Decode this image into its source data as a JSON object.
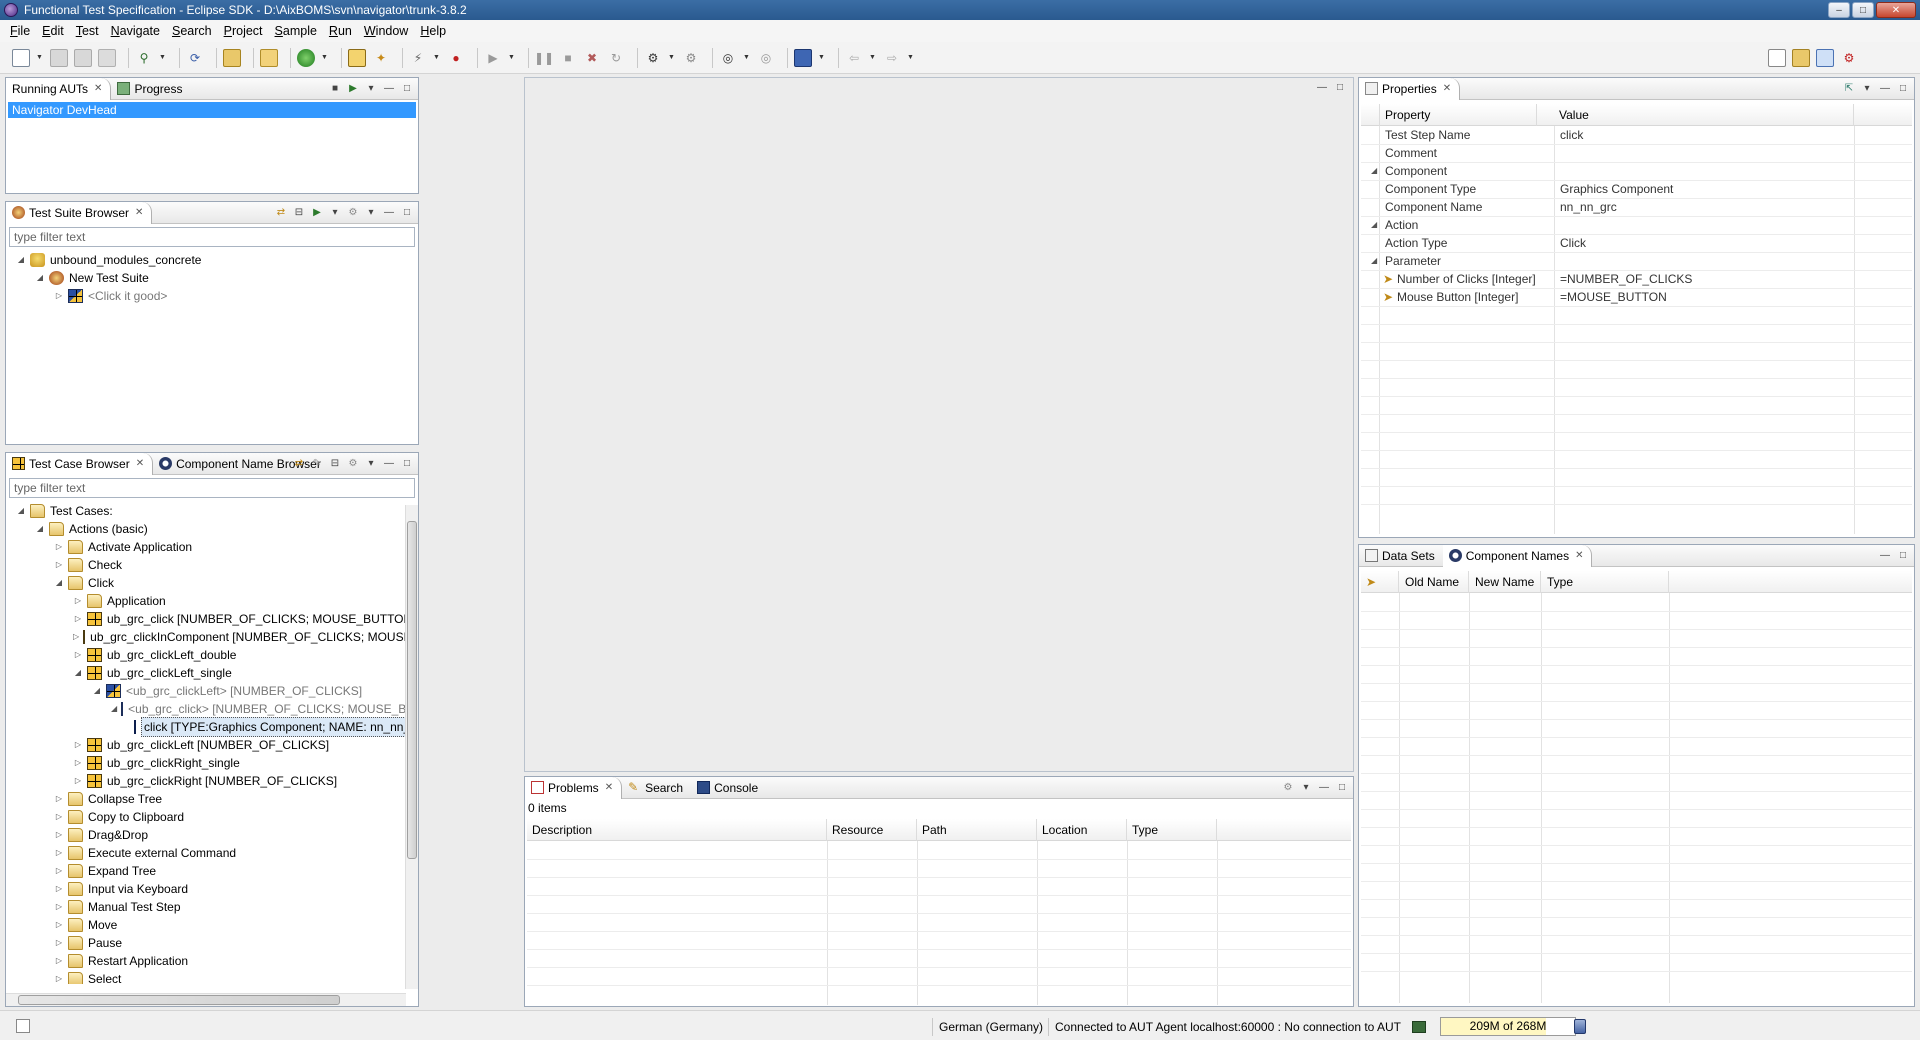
{
  "window": {
    "title": "Functional Test Specification - Eclipse SDK - D:\\AixBOMS\\svn\\navigator\\trunk-3.8.2"
  },
  "menu": [
    "File",
    "Edit",
    "Test",
    "Navigate",
    "Search",
    "Project",
    "Sample",
    "Run",
    "Window",
    "Help"
  ],
  "running_auts": {
    "tabs": [
      "Running AUTs",
      "Progress"
    ],
    "items": [
      "Navigator DevHead"
    ]
  },
  "test_suite_browser": {
    "tab": "Test Suite Browser",
    "filter_placeholder": "type filter text",
    "tree": [
      {
        "label": "unbound_modules_concrete"
      },
      {
        "label": "New Test Suite"
      },
      {
        "label": "<Click it good>"
      }
    ]
  },
  "test_case_browser": {
    "tabs": [
      "Test Case Browser",
      "Component Name Browser"
    ],
    "filter_placeholder": "type filter text",
    "tree": [
      {
        "label": "Test Cases:"
      },
      {
        "label": "Actions (basic)"
      },
      {
        "label": "Activate Application"
      },
      {
        "label": "Check"
      },
      {
        "label": "Click"
      },
      {
        "label": "Application"
      },
      {
        "label": "ub_grc_click [NUMBER_OF_CLICKS; MOUSE_BUTTON]"
      },
      {
        "label": "ub_grc_clickInComponent [NUMBER_OF_CLICKS; MOUSE_BUTTON; X_PO"
      },
      {
        "label": "ub_grc_clickLeft_double"
      },
      {
        "label": "ub_grc_clickLeft_single"
      },
      {
        "label": "<ub_grc_clickLeft> [NUMBER_OF_CLICKS]"
      },
      {
        "label": "<ub_grc_click> [NUMBER_OF_CLICKS; MOUSE_BUTTON]"
      },
      {
        "label": "click [TYPE:Graphics Component; NAME: nn_nn_grc; ACTION:"
      },
      {
        "label": "ub_grc_clickLeft [NUMBER_OF_CLICKS]"
      },
      {
        "label": "ub_grc_clickRight_single"
      },
      {
        "label": "ub_grc_clickRight [NUMBER_OF_CLICKS]"
      },
      {
        "label": "Collapse Tree"
      },
      {
        "label": "Copy to Clipboard"
      },
      {
        "label": "Drag&Drop"
      },
      {
        "label": "Execute external Command"
      },
      {
        "label": "Expand Tree"
      },
      {
        "label": "Input via Keyboard"
      },
      {
        "label": "Manual Test Step"
      },
      {
        "label": "Move"
      },
      {
        "label": "Pause"
      },
      {
        "label": "Restart Application"
      },
      {
        "label": "Select"
      }
    ]
  },
  "problems": {
    "tabs": [
      "Problems",
      "Search",
      "Console"
    ],
    "count": "0 items",
    "columns": [
      "Description",
      "Resource",
      "Path",
      "Location",
      "Type"
    ]
  },
  "properties": {
    "tab": "Properties",
    "columns": [
      "Property",
      "Value"
    ],
    "rows": [
      {
        "property": "Test Step Name",
        "value": "click"
      },
      {
        "property": "Comment",
        "value": ""
      },
      {
        "property": "Component",
        "value": ""
      },
      {
        "property": "Component Type",
        "value": "Graphics Component"
      },
      {
        "property": "Component Name",
        "value": "nn_nn_grc"
      },
      {
        "property": "Action",
        "value": ""
      },
      {
        "property": "Action Type",
        "value": "Click"
      },
      {
        "property": "Parameter",
        "value": ""
      },
      {
        "property": "Number of Clicks [Integer]",
        "value": "=NUMBER_OF_CLICKS"
      },
      {
        "property": "Mouse Button [Integer]",
        "value": "=MOUSE_BUTTON"
      }
    ]
  },
  "component_names": {
    "tabs": [
      "Data Sets",
      "Component Names"
    ],
    "columns": [
      "Old Name",
      "New Name",
      "Type"
    ]
  },
  "status": {
    "locale": "German (Germany)",
    "connection": "Connected to AUT Agent localhost:60000 : No connection to AUT",
    "memory": "209M of 268M",
    "memory_fraction": 0.78
  }
}
